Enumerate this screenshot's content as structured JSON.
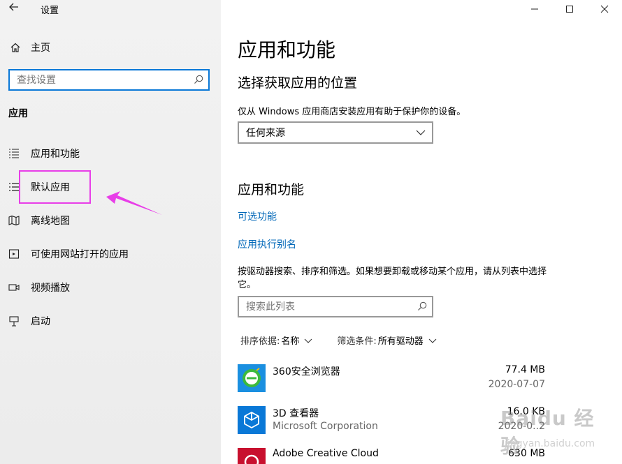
{
  "window": {
    "title": "设置",
    "controls": [
      "minimize",
      "maximize",
      "close"
    ]
  },
  "sidebar": {
    "home_label": "主页",
    "search_placeholder": "查找设置",
    "section_title": "应用",
    "items": [
      {
        "label": "应用和功能",
        "icon": "list-icon"
      },
      {
        "label": "默认应用",
        "icon": "default-apps-icon",
        "highlighted": true
      },
      {
        "label": "离线地图",
        "icon": "map-icon"
      },
      {
        "label": "可使用网站打开的应用",
        "icon": "web-app-icon"
      },
      {
        "label": "视频播放",
        "icon": "video-icon"
      },
      {
        "label": "启动",
        "icon": "startup-icon"
      }
    ]
  },
  "main": {
    "title": "应用和功能",
    "install_source": {
      "heading": "选择获取应用的位置",
      "description": "仅从 Windows 应用商店安装应用有助于保护你的设备。",
      "dropdown_value": "任何来源"
    },
    "apps_section": {
      "heading": "应用和功能",
      "link_optional": "可选功能",
      "link_alias": "应用执行别名",
      "description": "按驱动器搜索、排序和筛选。如果想要卸载或移动某个应用，请从列表中选择它。",
      "search_placeholder": "搜索此列表",
      "sort_label": "排序依据:",
      "sort_value": "名称",
      "filter_label": "筛选条件:",
      "filter_value": "所有驱动器",
      "apps": [
        {
          "name": "360安全浏览器",
          "publisher": "",
          "size": "77.4 MB",
          "date": "2020-07-07",
          "color": "#1a8fe0"
        },
        {
          "name": "3D 查看器",
          "publisher": "Microsoft Corporation",
          "size": "16.0 KB",
          "date": "2020-0..2",
          "color": "#0a78d7"
        },
        {
          "name": "Adobe Creative Cloud",
          "publisher": "",
          "size": "630 MB",
          "date": "",
          "color": "#c8102e"
        }
      ]
    }
  },
  "annotation": {
    "color": "#e83ee8"
  },
  "watermark": {
    "text": "Baidu 经验",
    "url": "jingyan.baidu.com"
  }
}
